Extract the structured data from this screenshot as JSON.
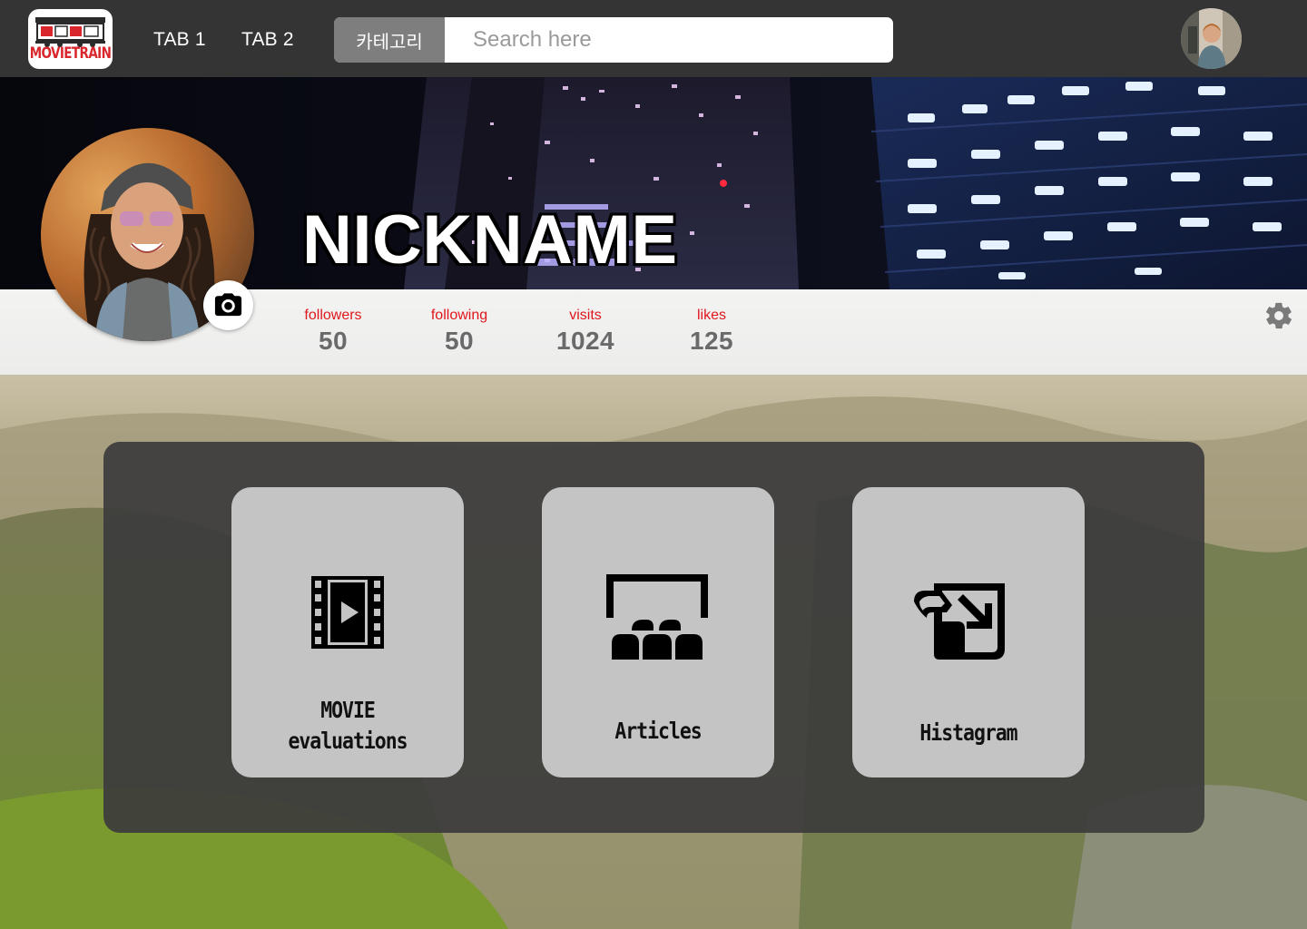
{
  "app": {
    "logo_text": "MOVIETRAIN"
  },
  "nav": {
    "tabs": [
      {
        "label": "TAB 1"
      },
      {
        "label": "TAB 2"
      }
    ],
    "category_button": "카테고리",
    "search_placeholder": "Search here"
  },
  "profile": {
    "nickname": "NICKNAME",
    "stats": [
      {
        "label": "followers",
        "value": "50"
      },
      {
        "label": "following",
        "value": "50"
      },
      {
        "label": "visits",
        "value": "1024"
      },
      {
        "label": "likes",
        "value": "125"
      }
    ]
  },
  "cards": [
    {
      "label_line1": "MOVIE",
      "label_line2": "evaluations",
      "icon": "film-play-icon"
    },
    {
      "label_line1": "Articles",
      "icon": "theater-audience-icon"
    },
    {
      "label_line1": "Histagram",
      "icon": "photo-gallery-icon"
    }
  ],
  "colors": {
    "topbar": "#343434",
    "accent_red": "#e0161c",
    "card_bg": "#c4c4c4",
    "panel_bg": "#3c3c3c"
  },
  "icons": {
    "camera": "camera-icon",
    "settings": "gear-icon",
    "avatar": "user-avatar"
  }
}
